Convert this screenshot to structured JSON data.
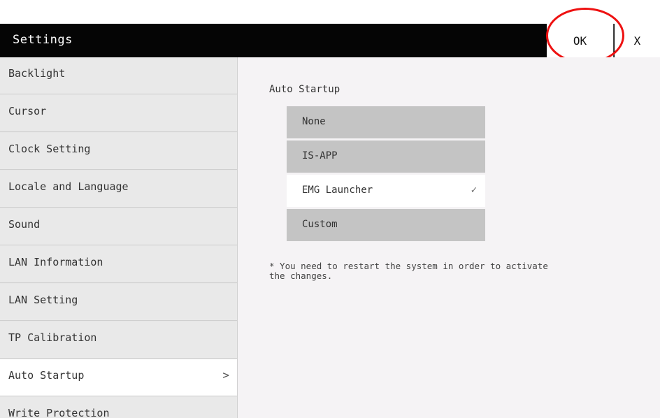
{
  "header": {
    "title": "Settings",
    "ok_label": "OK",
    "close_label": "X"
  },
  "sidebar": {
    "items": [
      {
        "label": "Backlight"
      },
      {
        "label": "Cursor"
      },
      {
        "label": "Clock Setting"
      },
      {
        "label": "Locale and Language"
      },
      {
        "label": "Sound"
      },
      {
        "label": "LAN Information"
      },
      {
        "label": "LAN Setting"
      },
      {
        "label": "TP Calibration"
      },
      {
        "label": "Auto Startup",
        "active": true,
        "chevron": ">"
      },
      {
        "label": "Write Protection"
      }
    ]
  },
  "main": {
    "section_title": "Auto Startup",
    "options": [
      {
        "label": "None"
      },
      {
        "label": "IS-APP"
      },
      {
        "label": "EMG Launcher",
        "selected": true,
        "check": "✓"
      },
      {
        "label": "Custom"
      }
    ],
    "note": "* You need to restart the system in order to activate\nthe changes."
  },
  "colors": {
    "header_bg": "#050505",
    "sidebar_bg": "#e9e9e9",
    "option_bg": "#c4c4c4",
    "annotation": "#e11111"
  }
}
